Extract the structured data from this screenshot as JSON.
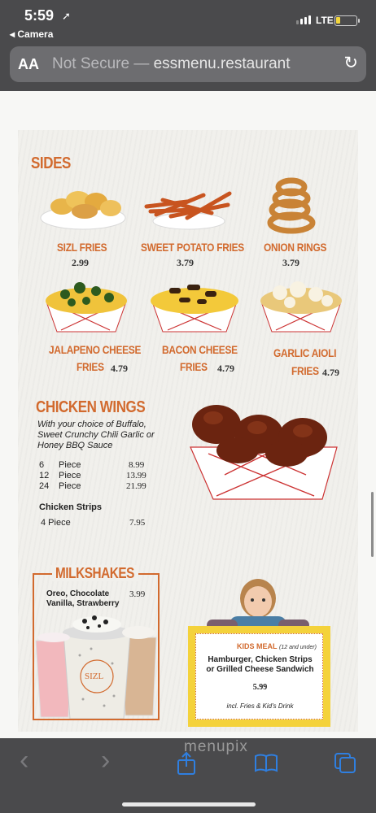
{
  "status": {
    "time": "5:59",
    "location_arrow": "➚",
    "back_app": "◂ Camera",
    "network": "LTE",
    "battery_level": 0.22
  },
  "browser": {
    "aa_label": "AA",
    "security": "Not Secure —",
    "domain": "essmenu.restaurant",
    "reload_icon": "↻"
  },
  "menu": {
    "sides": {
      "title": "SIDES",
      "items": [
        {
          "name": "SIZL FRIES",
          "price": "2.99"
        },
        {
          "name": "SWEET POTATO FRIES",
          "price": "3.79"
        },
        {
          "name": "ONION RINGS",
          "price": "3.79"
        },
        {
          "name_line1": "JALAPENO CHEESE",
          "name_line2": "FRIES",
          "price": "4.79"
        },
        {
          "name_line1": "BACON CHEESE",
          "name_line2": "FRIES",
          "price": "4.79"
        },
        {
          "name_line1": "GARLIC AIOLI",
          "name_line2": "FRIES",
          "price": "4.79"
        }
      ]
    },
    "wings": {
      "title": "CHICKEN WINGS",
      "description": "With your choice of Buffalo, Sweet Crunchy Chili Garlic or Honey BBQ Sauce",
      "rows": [
        {
          "qty": "6",
          "unit": "Piece",
          "price": "8.99"
        },
        {
          "qty": "12",
          "unit": "Piece",
          "price": "13.99"
        },
        {
          "qty": "24",
          "unit": "Piece",
          "price": "21.99"
        }
      ],
      "strips_title": "Chicken Strips",
      "strips_label": "4 Piece",
      "strips_price": "7.95"
    },
    "milkshakes": {
      "title": "MILKSHAKES",
      "flavors_line1": "Oreo, Chocolate",
      "flavors_line2": "Vanilla, Strawberry",
      "price": "3.99",
      "cup_logo": "SIZL"
    },
    "kids": {
      "title": "KIDS MEAL",
      "age": "(12 and under)",
      "items_line1": "Hamburger, Chicken Strips",
      "items_line2": "or Grilled Cheese Sandwich",
      "price": "5.99",
      "note": "incl. Fries & Kid's Drink"
    }
  },
  "toolbar": {
    "back_icon": "‹",
    "forward_icon": "›",
    "share_icon": "share-icon",
    "bookmarks_icon": "book-icon",
    "tabs_icon": "tabs-icon",
    "watermark": "menupix"
  },
  "colors": {
    "accent": "#d26a2e",
    "kids_bg": "#f4d23b",
    "link_blue": "#2f7fe0"
  }
}
